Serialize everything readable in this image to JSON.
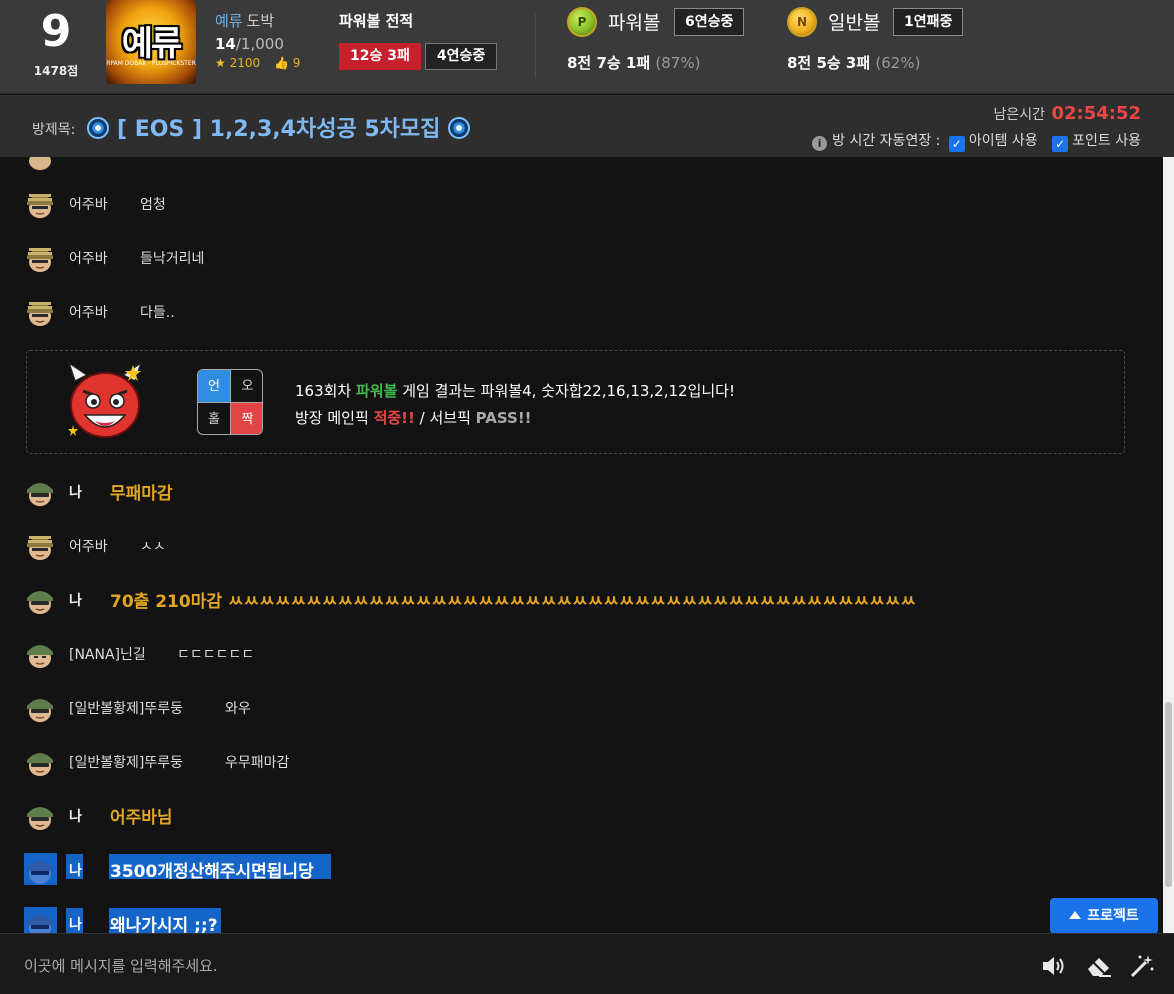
{
  "profile": {
    "level": "9",
    "points": "1478점",
    "logo_text": "예류",
    "logo_sub": "RPAM DOBAK · PLUSPICKSTER",
    "name": "예류",
    "name_sub": "도박",
    "exp_current": "14",
    "exp_max": "/1,000",
    "stars": "2100",
    "likes": "9"
  },
  "record": {
    "title": "파워볼 전적",
    "win_loss": "12승 3패",
    "streak": "4연승중"
  },
  "powerball": {
    "icon_letter": "P",
    "name": "파워볼",
    "streak": "6연승중",
    "stats": "8전 7승 1패",
    "pct": "(87%)"
  },
  "normalball": {
    "icon_letter": "N",
    "name": "일반볼",
    "streak": "1연패중",
    "stats": "8전 5승 3패",
    "pct": "(62%)"
  },
  "room": {
    "label": "방제목:",
    "title": "[ EOS ] 1,2,3,4차성공 5차모집",
    "timer_label": "남은시간",
    "timer_value": "02:54:52",
    "auto_extend_label": "방 시간 자동연장 :",
    "item_label": "아이템 사용",
    "point_label": "포인트 사용"
  },
  "messages": [
    {
      "nick": "어주바",
      "text": "엄청"
    },
    {
      "nick": "어주바",
      "text": "들낙거리네"
    },
    {
      "nick": "어주바",
      "text": "다들.."
    },
    {
      "nick": "나",
      "text": "무패마감"
    },
    {
      "nick": "어주바",
      "text": "ㅅㅅ"
    },
    {
      "nick": "나",
      "text": "70출 210마감 ㅆㅆㅆㅆㅆㅆㅆㅆㅆㅆㅆㅆㅆㅆㅆㅆㅆㅆㅆㅆㅆㅆㅆㅆㅆㅆㅆㅆㅆㅆㅆㅆㅆㅆㅆㅆㅆㅆㅆㅆㅆㅆㅆㅆ"
    },
    {
      "nick": "[NANA]닌길",
      "text": "ㄷㄷㄷㄷㄷㄷ"
    },
    {
      "nick": "[일반볼황제]뚜루둥",
      "text": "와우"
    },
    {
      "nick": "[일반볼황제]뚜루둥",
      "text": "우무패마감"
    },
    {
      "nick": "나",
      "text": "어주바님"
    },
    {
      "nick": "나",
      "text": "3500개정산해주시면됩니당"
    },
    {
      "nick": "나",
      "text": "왜나가시지 ;;?"
    }
  ],
  "result": {
    "grid": [
      "언",
      "오",
      "홀",
      "짝"
    ],
    "line1_pre": "163회차",
    "line1_game": "파워볼",
    "line1_post": "게임 결과는 파워볼4, 숫자합22,16,13,2,12입니다!",
    "line2_pre": "방장 메인픽",
    "line2_hit": "적중!!",
    "line2_mid": "/ 서브픽",
    "line2_pass": "PASS!!"
  },
  "project_button": "프로젝트",
  "input": {
    "placeholder": "이곳에 메시지를 입력해주세요."
  },
  "colors": {
    "accent_blue": "#1a73e8",
    "win_red": "#c5202b",
    "my_message": "#e3a624",
    "timer_red": "#e94646"
  }
}
